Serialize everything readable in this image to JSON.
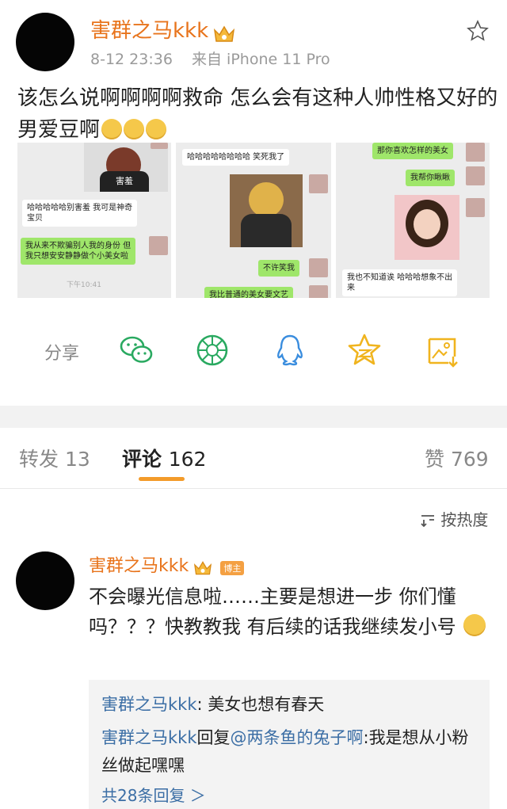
{
  "post": {
    "username": "害群之马kkk",
    "time": "8-12 23:36",
    "source": "来自 iPhone 11 Pro",
    "text": "该怎么说啊啊啊啊救命 怎么会有这种人帅性格又好的男爱豆啊",
    "emoji_count": 3
  },
  "screenshots": {
    "s1": {
      "photo_caption": "害羞",
      "msg1": "哈哈哈哈哈别害羞 我可是神奇",
      "msg1b": "宝贝",
      "msg2": "我从来不欺骗别人我的身份 但",
      "msg2b": "我只想安安静静做个小美女啦",
      "time": "下午10:41"
    },
    "s2": {
      "msg1": "哈哈哈哈哈哈哈哈 笑死我了",
      "msg2": "不许笑我",
      "msg3": "我比普通的美女要文艺"
    },
    "s3": {
      "msg1": "那你喜欢怎样的美女",
      "msg2": "我帮你瞅瞅",
      "msg3": "我也不知道诶 哈哈哈想象不出",
      "msg3b": "来"
    }
  },
  "share": {
    "label": "分享",
    "icons": [
      "wechat-icon",
      "moments-icon",
      "qq-icon",
      "qzone-icon",
      "save-image-icon"
    ]
  },
  "tabs": {
    "repost_label": "转发",
    "repost_count": "13",
    "comment_label": "评论",
    "comment_count": "162",
    "like_label": "赞",
    "like_count": "769"
  },
  "sort": {
    "label": "按热度"
  },
  "comment": {
    "username": "害群之马kkk",
    "badge": "博主",
    "text": "不会曝光信息啦……主要是想进一步 你们懂吗？？？快教教我 有后续的话我继续发小号",
    "replies": [
      {
        "author": "害群之马kkk",
        "sep": ": ",
        "text": "美女也想有春天"
      },
      {
        "author": "害群之马kkk",
        "mid": "回复",
        "mention": "@两条鱼的兔子啊",
        "sep": ":",
        "text": "我是想从小粉丝做起嘿嘿"
      }
    ],
    "more": "共28条回复 ＞"
  },
  "colors": {
    "username": "#e8741c",
    "link": "#3b6ea5",
    "accent": "#f39b2a"
  }
}
